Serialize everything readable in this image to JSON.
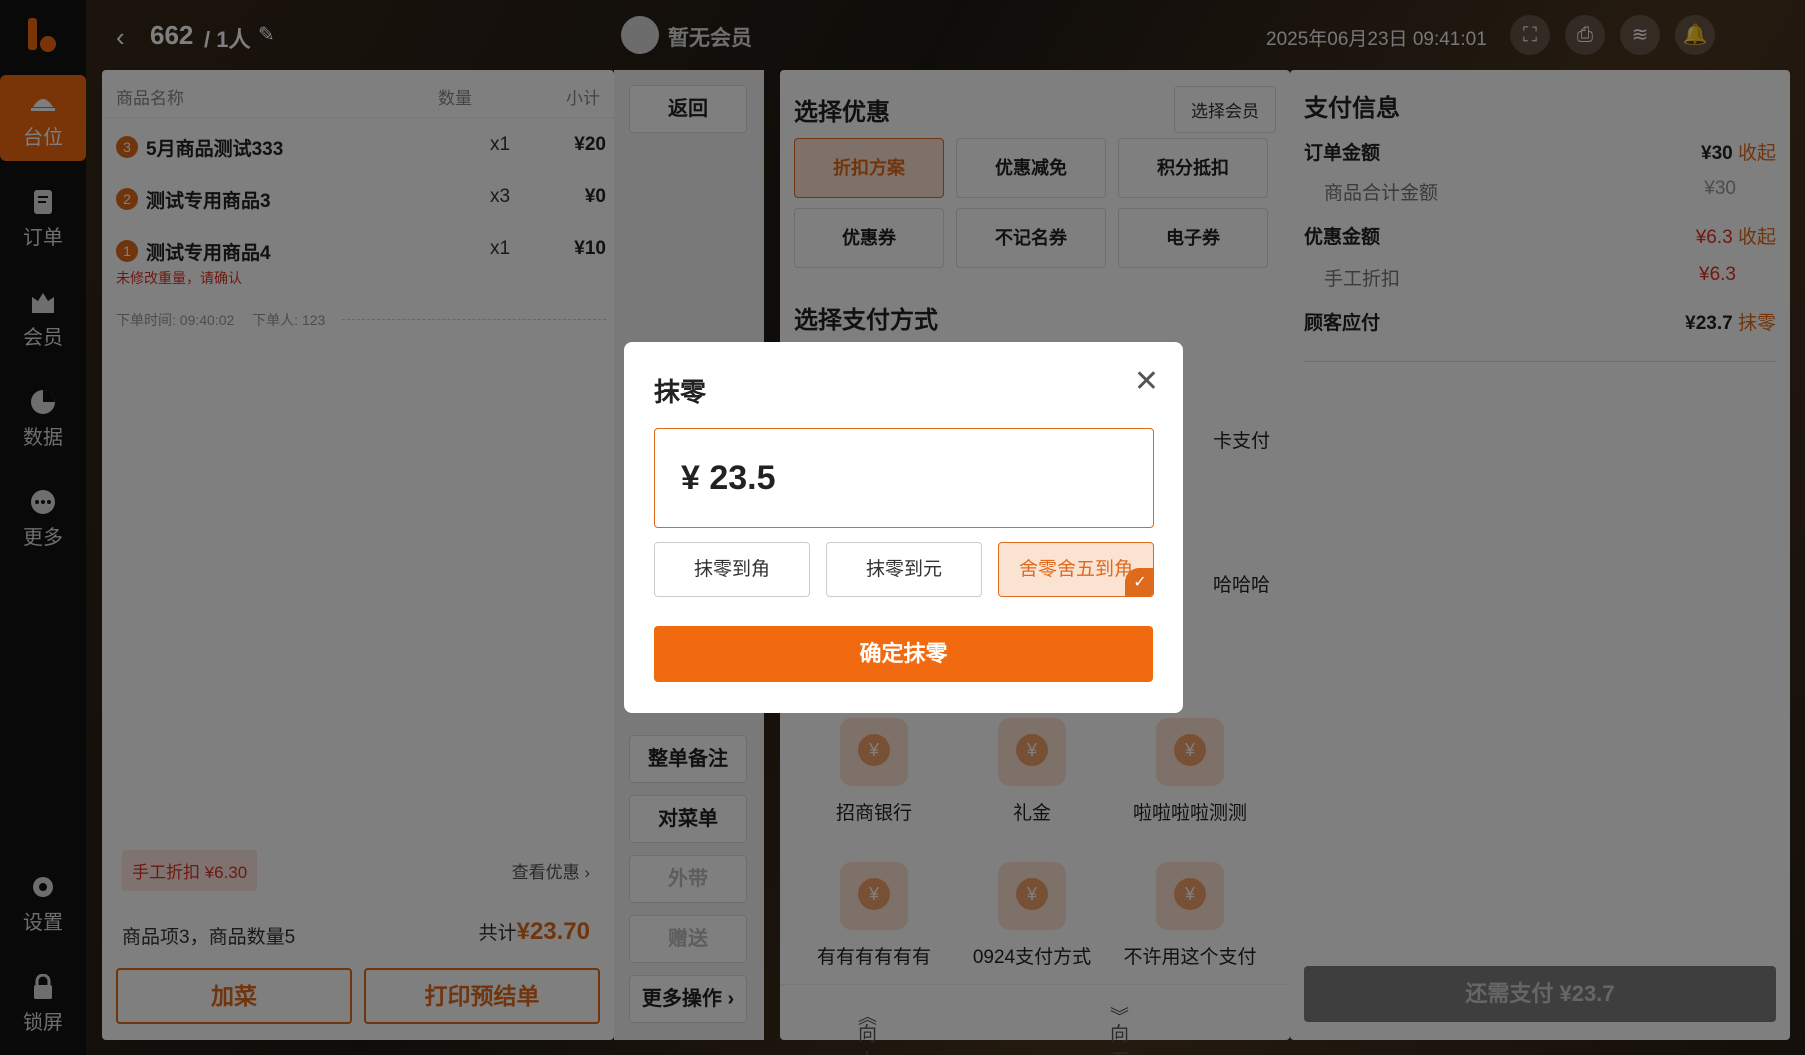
{
  "topbar": {
    "back": "‹",
    "table": "662",
    "people": "/ 1人",
    "member": "暂无会员",
    "time": "2025年06月23日 09:41:01"
  },
  "sidebar": {
    "items": [
      {
        "label": "台位"
      },
      {
        "label": "订单"
      },
      {
        "label": "会员"
      },
      {
        "label": "数据"
      },
      {
        "label": "更多"
      },
      {
        "label": "设置"
      },
      {
        "label": "锁屏"
      }
    ]
  },
  "order": {
    "headers": {
      "name": "商品名称",
      "qty": "数量",
      "subtotal": "小计"
    },
    "items": [
      {
        "index": "3",
        "name": "5月商品测试333",
        "qty": "x1",
        "subtotal": "¥20"
      },
      {
        "index": "2",
        "name": "测试专用商品3",
        "qty": "x3",
        "subtotal": "¥0"
      },
      {
        "index": "1",
        "name": "测试专用商品4",
        "qty": "x1",
        "subtotal": "¥10",
        "warning": "未修改重量，请确认"
      }
    ],
    "meta_time": "下单时间: 09:40:02",
    "meta_user": "下单人: 123",
    "discount_tag": "手工折扣 ¥6.30",
    "view_discount": "查看优惠 ›",
    "summary": "商品项3，商品数量5",
    "total_label": "共计",
    "total_value": "¥23.70",
    "add_button": "加菜",
    "print_button": "打印预结单"
  },
  "middle": {
    "back": "返回",
    "note": "整单备注",
    "check": "对菜单",
    "takeaway": "外带",
    "gift": "赠送",
    "more": "更多操作 ›"
  },
  "pay_panel": {
    "promo_title": "选择优惠",
    "choose_member": "选择会员",
    "promos": [
      "折扣方案",
      "优惠减免",
      "积分抵扣",
      "优惠券",
      "不记名券",
      "电子券"
    ],
    "method_title": "选择支付方式",
    "partial_labels": [
      "卡支付",
      "哈哈哈"
    ],
    "methods": [
      "招商银行",
      "礼金",
      "啦啦啦啦测测",
      "有有有有有有",
      "0924支付方式",
      "不许用这个支付"
    ],
    "scroll_up": "向上滑",
    "scroll_down": "向下滑"
  },
  "info": {
    "title": "支付信息",
    "order_amount_label": "订单金额",
    "order_amount": "¥30",
    "collapse1": "收起",
    "goods_total_label": "商品合计金额",
    "goods_total": "¥30",
    "discount_label": "优惠金额",
    "discount": "¥6.3",
    "collapse2": "收起",
    "manual_discount_label": "手工折扣",
    "manual_discount": "¥6.3",
    "due_label": "顾客应付",
    "due": "¥23.7",
    "round_off": "抹零",
    "remaining": "还需支付 ¥23.7"
  },
  "modal": {
    "title": "抹零",
    "amount": "¥ 23.5",
    "options": [
      "抹零到角",
      "抹零到元",
      "舍零舍五到角"
    ],
    "selected_index": 2,
    "confirm": "确定抹零"
  },
  "colors": {
    "accent": "#f26a0f",
    "warning": "#e03020"
  }
}
